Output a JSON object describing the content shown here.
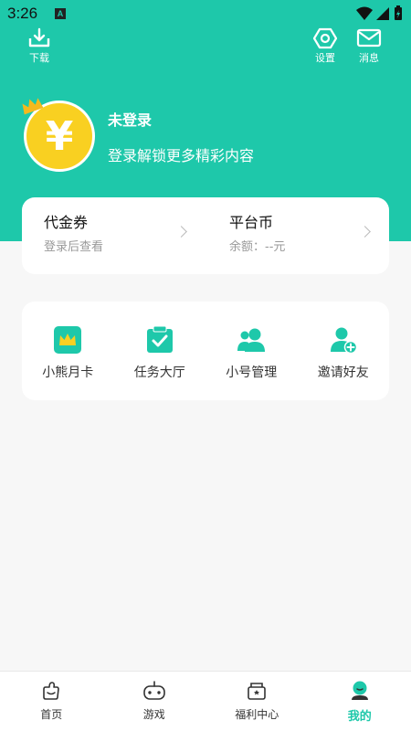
{
  "colors": {
    "accent": "#1ec8aa",
    "avatar": "#f9d021",
    "crown": "#f5b91d"
  },
  "status_bar": {
    "time": "3:26",
    "notification_badge": "A"
  },
  "header": {
    "download_label": "下载",
    "settings_label": "设置",
    "messages_label": "消息",
    "login_title": "未登录",
    "login_subtitle": "登录解锁更多精彩内容",
    "avatar_symbol": "¥"
  },
  "wallet": {
    "coupon": {
      "title": "代金券",
      "subtitle": "登录后查看"
    },
    "coin": {
      "title": "平台币",
      "subtitle": "余额：--元"
    }
  },
  "services": [
    {
      "label": "小熊月卡",
      "icon": "crown-card-icon"
    },
    {
      "label": "任务大厅",
      "icon": "task-check-icon"
    },
    {
      "label": "小号管理",
      "icon": "accounts-icon"
    },
    {
      "label": "邀请好友",
      "icon": "add-friend-icon"
    }
  ],
  "tabbar": {
    "active": "我的",
    "items": [
      {
        "label": "首页",
        "icon": "home-icon"
      },
      {
        "label": "游戏",
        "icon": "gamepad-icon"
      },
      {
        "label": "福利中心",
        "icon": "gift-icon"
      },
      {
        "label": "我的",
        "icon": "profile-icon"
      }
    ]
  }
}
